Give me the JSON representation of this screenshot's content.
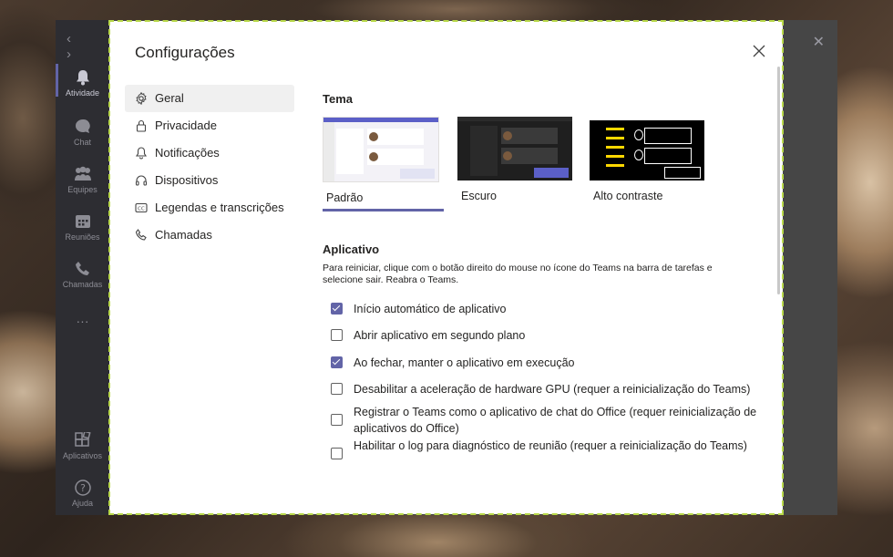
{
  "window": {
    "rail": [
      {
        "label": "Atividade",
        "icon": "bell-icon",
        "active": true
      },
      {
        "label": "Chat",
        "icon": "chat-icon"
      },
      {
        "label": "Equipes",
        "icon": "teams-icon"
      },
      {
        "label": "Reuniões",
        "icon": "calendar-icon"
      },
      {
        "label": "Chamadas",
        "icon": "phone-icon"
      },
      {
        "label": "Aplicativos",
        "icon": "apps-icon"
      },
      {
        "label": "Ajuda",
        "icon": "help-icon"
      }
    ],
    "more_label": "···"
  },
  "dialog": {
    "title": "Configurações",
    "nav": [
      {
        "label": "Geral",
        "icon": "gear-icon",
        "active": true
      },
      {
        "label": "Privacidade",
        "icon": "lock-icon"
      },
      {
        "label": "Notificações",
        "icon": "bell-icon"
      },
      {
        "label": "Dispositivos",
        "icon": "headset-icon"
      },
      {
        "label": "Legendas e transcrições",
        "icon": "captions-icon"
      },
      {
        "label": "Chamadas",
        "icon": "phone-icon"
      }
    ],
    "theme_heading": "Tema",
    "themes": [
      {
        "label": "Padrão",
        "selected": true
      },
      {
        "label": "Escuro",
        "selected": false
      },
      {
        "label": "Alto contraste",
        "selected": false
      }
    ],
    "app_heading": "Aplicativo",
    "app_description": "Para reiniciar, clique com o botão direito do mouse no ícone do Teams na barra de tarefas e selecione sair. Reabra o Teams.",
    "options": [
      {
        "label": "Início automático de aplicativo",
        "checked": true
      },
      {
        "label": "Abrir aplicativo em segundo plano",
        "checked": false
      },
      {
        "label": "Ao fechar, manter o aplicativo em execução",
        "checked": true
      },
      {
        "label": "Desabilitar a aceleração de hardware GPU (requer a reinicialização do Teams)",
        "checked": false
      },
      {
        "label": "Registrar o Teams como o aplicativo de chat do Office (requer reinicialização de aplicativos do Office)",
        "checked": false
      },
      {
        "label": "Habilitar o log para diagnóstico de reunião (requer a reinicialização do Teams)",
        "checked": false
      }
    ]
  },
  "colors": {
    "accent": "#6264a7"
  }
}
